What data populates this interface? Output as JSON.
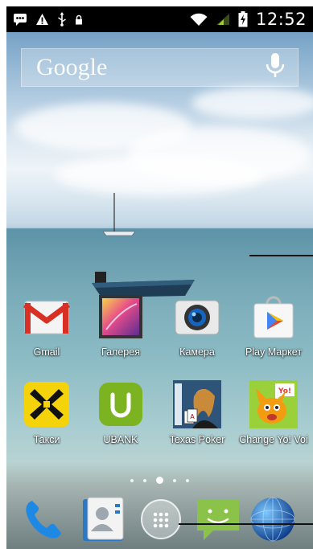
{
  "status_bar": {
    "left_icons": [
      "bbm-chat-icon",
      "warning-icon",
      "usb-icon",
      "lock-icon"
    ],
    "right_icons": [
      "wifi-icon",
      "signal-icon",
      "battery-charging-icon"
    ],
    "time": "12:52"
  },
  "search_widget": {
    "logo_text": "Google",
    "mic_icon": "microphone-icon"
  },
  "apps": [
    {
      "label": "Gmail",
      "icon": "gmail-icon"
    },
    {
      "label": "Галерея",
      "icon": "gallery-icon"
    },
    {
      "label": "Камера",
      "icon": "camera-icon"
    },
    {
      "label": "Play Маркет",
      "icon": "play-store-icon"
    },
    {
      "label": "Такси",
      "icon": "taxi-icon"
    },
    {
      "label": "UBANK",
      "icon": "ubank-icon"
    },
    {
      "label": "Texas Poker",
      "icon": "texas-poker-icon"
    },
    {
      "label": "Change Yo! Voi",
      "icon": "change-yo-voice-icon"
    }
  ],
  "home_pages": {
    "count": 5,
    "active_index": 2
  },
  "dock": [
    {
      "icon": "phone-icon"
    },
    {
      "icon": "contacts-icon"
    },
    {
      "icon": "app-drawer-icon"
    },
    {
      "icon": "messaging-icon"
    },
    {
      "icon": "browser-globe-icon"
    }
  ],
  "colors": {
    "status_bar_bg": "#000000",
    "gmail_red": "#d93025",
    "taxi_yellow": "#f5d30a",
    "ubank_green": "#7bb420",
    "messaging_green": "#8bc34a",
    "phone_blue": "#1e88e5"
  }
}
